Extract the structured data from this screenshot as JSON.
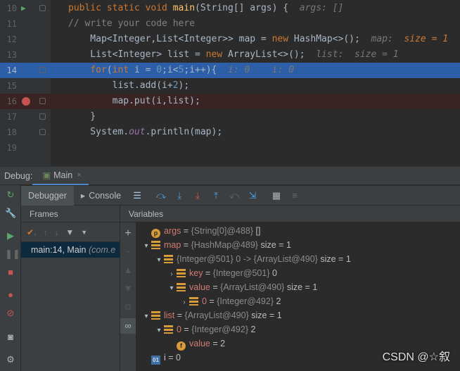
{
  "editor": {
    "lines": [
      {
        "num": "10",
        "parts": [
          [
            "kw",
            "public static void "
          ],
          [
            "fn",
            "main"
          ],
          [
            "",
            "(String[] args) {  "
          ],
          [
            "inl",
            "args: []"
          ]
        ]
      },
      {
        "num": "11",
        "parts": [
          [
            "cm",
            "// write your code here"
          ]
        ]
      },
      {
        "num": "12",
        "parts": [
          [
            "",
            "    Map<Integer,List<Integer>> map = "
          ],
          [
            "kw",
            "new "
          ],
          [
            "",
            "HashMap<>();  "
          ],
          [
            "inl",
            "map:  "
          ],
          [
            "inlv",
            "size = 1"
          ]
        ]
      },
      {
        "num": "13",
        "parts": [
          [
            "",
            "    List<Integer> list = "
          ],
          [
            "kw",
            "new "
          ],
          [
            "",
            "ArrayList<>();  "
          ],
          [
            "inl",
            "list:  size = 1"
          ]
        ]
      },
      {
        "num": "14",
        "parts": [
          [
            "kw",
            "    for"
          ],
          [
            "",
            "("
          ],
          [
            "kw",
            "int "
          ],
          [
            "",
            "i = "
          ],
          [
            "num",
            "0"
          ],
          [
            "",
            ";i<"
          ],
          [
            "num",
            "5"
          ],
          [
            "",
            ";i++){  "
          ],
          [
            "inl",
            "i: 0    i: 0"
          ]
        ]
      },
      {
        "num": "15",
        "parts": [
          [
            "",
            "        list.add(i+"
          ],
          [
            "num",
            "2"
          ],
          [
            "",
            ");"
          ]
        ]
      },
      {
        "num": "16",
        "parts": [
          [
            "",
            "        map.put(i,list);"
          ]
        ]
      },
      {
        "num": "17",
        "parts": [
          [
            "",
            "    }"
          ]
        ]
      },
      {
        "num": "18",
        "parts": [
          [
            "",
            "    System."
          ],
          [
            "fld",
            "out"
          ],
          [
            "",
            ".println(map);"
          ]
        ]
      },
      {
        "num": "19",
        "parts": [
          [
            "",
            ""
          ]
        ]
      }
    ]
  },
  "debug": {
    "title": "Debug:",
    "session_tab": "Main",
    "tabs": {
      "debugger": "Debugger",
      "console": "Console"
    },
    "frames_label": "Frames",
    "variables_label": "Variables",
    "frame_item": "main:14, Main",
    "frame_item_pkg": "(com.e"
  },
  "variables": [
    {
      "indent": 0,
      "arrow": "",
      "icon": "p",
      "name": "args",
      "type": "{String[0]@488}",
      "value": "[]"
    },
    {
      "indent": 0,
      "arrow": "▾",
      "icon": "lines",
      "name": "map",
      "type": "{HashMap@489}",
      "value": "size = 1"
    },
    {
      "indent": 1,
      "arrow": "▾",
      "icon": "lines",
      "name": "",
      "type": "{Integer@501} 0 -> {ArrayList@490}",
      "value": "size = 1"
    },
    {
      "indent": 2,
      "arrow": "›",
      "icon": "lines",
      "name": "key",
      "type": "{Integer@501}",
      "value": "0"
    },
    {
      "indent": 2,
      "arrow": "▾",
      "icon": "lines",
      "name": "value",
      "type": "{ArrayList@490}",
      "value": "size = 1"
    },
    {
      "indent": 3,
      "arrow": "›",
      "icon": "lines",
      "name": "0",
      "type": "{Integer@492}",
      "value": "2"
    },
    {
      "indent": 0,
      "arrow": "▾",
      "icon": "lines",
      "name": "list",
      "type": "{ArrayList@490}",
      "value": "size = 1"
    },
    {
      "indent": 1,
      "arrow": "▾",
      "icon": "lines",
      "name": "0",
      "type": "{Integer@492}",
      "value": "2"
    },
    {
      "indent": 2,
      "arrow": "",
      "icon": "f",
      "name": "value",
      "type": "",
      "value": "2"
    },
    {
      "indent": 0,
      "arrow": "",
      "icon": "01",
      "name": "i",
      "type": "",
      "value": "0"
    }
  ],
  "watermark": "CSDN @☆叙"
}
